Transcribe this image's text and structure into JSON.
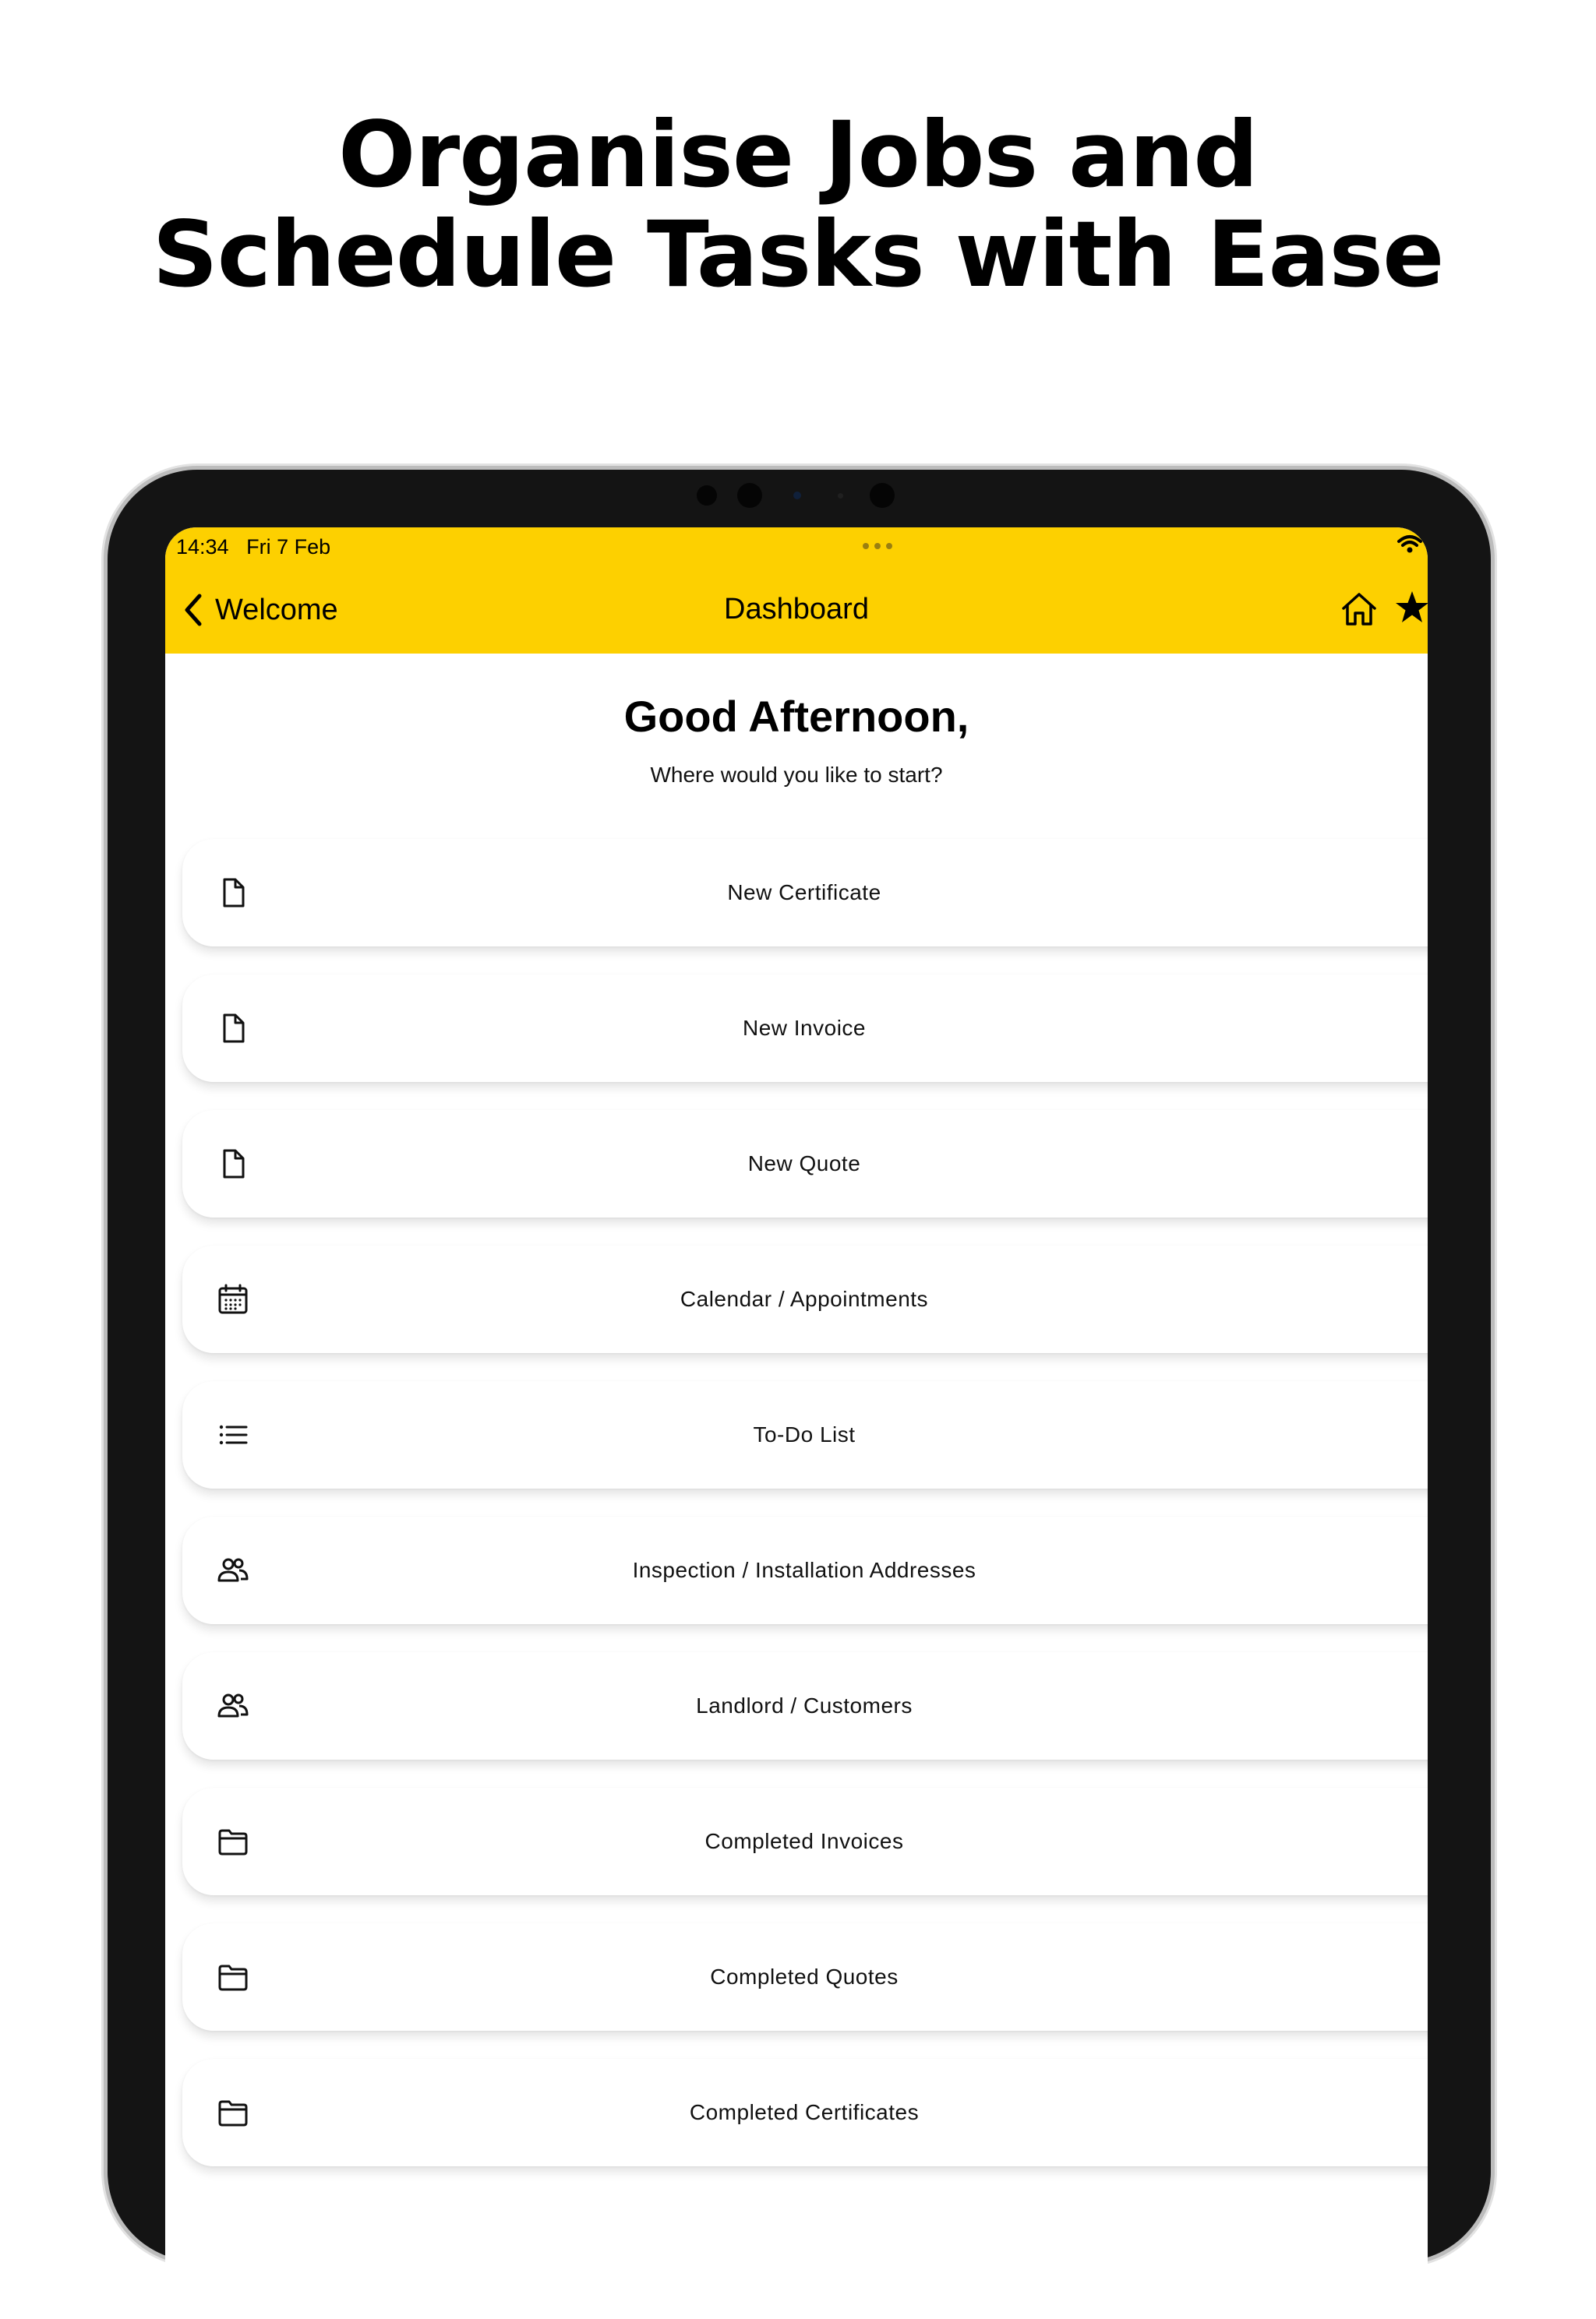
{
  "promo": {
    "headline_line1": "Organise Jobs and",
    "headline_line2": "Schedule Tasks with Ease"
  },
  "status_bar": {
    "time": "14:34",
    "date": "Fri 7 Feb"
  },
  "nav": {
    "back_label": "Welcome",
    "title": "Dashboard",
    "accent_color": "#fdd000"
  },
  "dashboard": {
    "greeting": "Good Afternoon,",
    "subtitle": "Where would you like to start?",
    "items": [
      {
        "label": "New Certificate",
        "icon": "document-icon"
      },
      {
        "label": "New Invoice",
        "icon": "document-icon"
      },
      {
        "label": "New Quote",
        "icon": "document-icon"
      },
      {
        "label": "Calendar / Appointments",
        "icon": "calendar-icon"
      },
      {
        "label": "To-Do List",
        "icon": "list-icon"
      },
      {
        "label": "Inspection / Installation Addresses",
        "icon": "people-icon"
      },
      {
        "label": "Landlord / Customers",
        "icon": "people-icon"
      },
      {
        "label": "Completed Invoices",
        "icon": "folder-icon"
      },
      {
        "label": "Completed Quotes",
        "icon": "folder-icon"
      },
      {
        "label": "Completed Certificates",
        "icon": "folder-icon"
      }
    ]
  }
}
